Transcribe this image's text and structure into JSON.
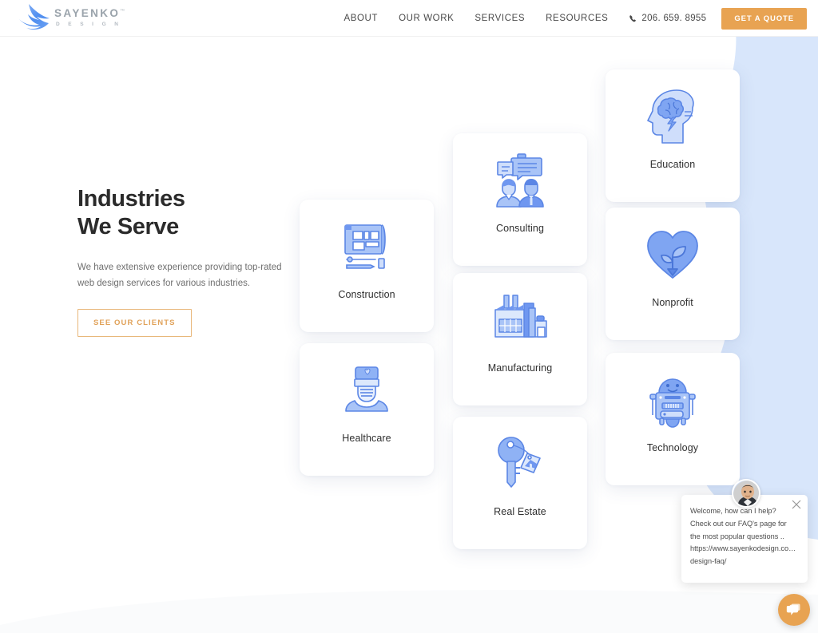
{
  "header": {
    "logo": {
      "title": "SAYENKO",
      "subtitle": "D E S I G N",
      "tm": "™",
      "icon": "swoosh-logo-icon"
    },
    "nav_items": [
      {
        "label": "ABOUT"
      },
      {
        "label": "OUR WORK"
      },
      {
        "label": "SERVICES"
      },
      {
        "label": "RESOURCES"
      }
    ],
    "phone": {
      "number": "206. 659. 8955",
      "icon": "phone-icon"
    },
    "quote_button": {
      "label": "GET A QUOTE",
      "color": "#e8a352"
    }
  },
  "intro": {
    "heading_line1": "Industries",
    "heading_line2": "We Serve",
    "paragraph": "We have extensive experience providing top-rated web design services for various industries.",
    "button_label": "SEE OUR CLIENTS",
    "button_color": "#e0a158"
  },
  "cards": [
    {
      "id": "construction",
      "label": "Construction",
      "icon": "blueprint-icon"
    },
    {
      "id": "healthcare",
      "label": "Healthcare",
      "icon": "doctor-icon"
    },
    {
      "id": "consulting",
      "label": "Consulting",
      "icon": "people-chat-icon"
    },
    {
      "id": "manufacturing",
      "label": "Manufacturing",
      "icon": "factory-icon"
    },
    {
      "id": "realestate",
      "label": "Real Estate",
      "icon": "key-house-tag-icon"
    },
    {
      "id": "education",
      "label": "Education",
      "icon": "head-brain-icon"
    },
    {
      "id": "nonprofit",
      "label": "Nonprofit",
      "icon": "heart-sprout-icon"
    },
    {
      "id": "technology",
      "label": "Technology",
      "icon": "robot-icon"
    }
  ],
  "chat": {
    "avatar": "agent-avatar",
    "close_icon": "close-icon",
    "fab_icon": "chat-bubbles-icon",
    "fab_color": "#e8a352",
    "lines": [
      "Welcome, how can I help?",
      "Check out our FAQ's page for",
      "the most popular questions ..",
      "https://www.sayenkodesign.co…",
      "design-faq/"
    ]
  },
  "theme": {
    "icon_blue": "#6f97f0",
    "icon_blue_light": "#a9c4f7",
    "icon_blue_pale": "#cfdefb",
    "blob_blue": "#d8e6fb",
    "text_dark": "#2b2b2b",
    "text_muted": "#6f6f6f"
  }
}
